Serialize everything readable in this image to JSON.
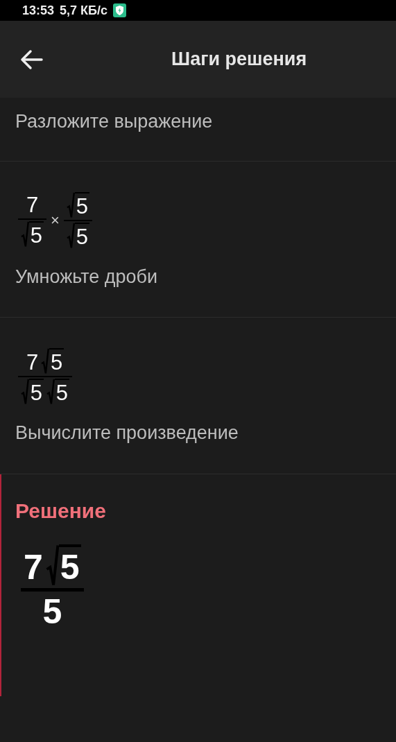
{
  "status_bar": {
    "time": "13:53",
    "speed": "5,7 КБ/с"
  },
  "header": {
    "title": "Шаги решения"
  },
  "steps": [
    {
      "caption": "Разложите выражение"
    },
    {
      "expression": [
        {
          "kind": "fraction",
          "num": [
            {
              "kind": "number",
              "text": "7"
            }
          ],
          "den": [
            {
              "kind": "sqrt",
              "text": "5"
            }
          ]
        },
        {
          "kind": "operator",
          "text": "×"
        },
        {
          "kind": "fraction",
          "num": [
            {
              "kind": "sqrt",
              "text": "5"
            }
          ],
          "den": [
            {
              "kind": "sqrt",
              "text": "5"
            }
          ]
        }
      ],
      "caption": "Умножьте дроби"
    },
    {
      "expression": [
        {
          "kind": "fraction",
          "num": [
            {
              "kind": "number",
              "text": "7"
            },
            {
              "kind": "sqrt",
              "text": "5"
            }
          ],
          "den": [
            {
              "kind": "sqrt",
              "text": "5"
            },
            {
              "kind": "sqrt",
              "text": "5"
            }
          ]
        }
      ],
      "caption": "Вычислите произведение"
    }
  ],
  "solution": {
    "title": "Решение",
    "expression": [
      {
        "kind": "fraction",
        "num": [
          {
            "kind": "number",
            "text": "7"
          },
          {
            "kind": "sqrt",
            "text": "5"
          }
        ],
        "den": [
          {
            "kind": "number",
            "text": "5"
          }
        ]
      }
    ]
  }
}
